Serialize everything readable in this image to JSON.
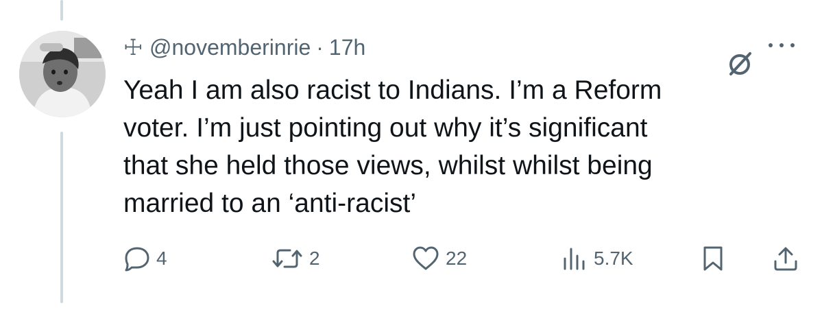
{
  "tweet": {
    "prefix_symbol": "☩",
    "handle": "@novemberinrie",
    "separator": "·",
    "time": "17h",
    "lines": [
      "Yeah I am also racist to Indians. I’m a Reform",
      "voter. I’m just pointing out why it’s significant",
      "that she held those views, whilst whilst being",
      "married to an ‘anti-racist’"
    ]
  },
  "actions": {
    "replies": "4",
    "reposts": "2",
    "likes": "22",
    "views": "5.7K"
  },
  "icons": {
    "reply": "speech-bubble-icon",
    "repost": "repost-arrows-icon",
    "like": "heart-icon",
    "views": "bar-chart-icon",
    "bookmark": "bookmark-icon",
    "share": "share-upload-icon",
    "verified": "slashed-circle-icon",
    "more": "ellipsis-icon"
  },
  "colors": {
    "text": "#0f1419",
    "muted": "#536471",
    "thread_line": "#cfd9de"
  }
}
